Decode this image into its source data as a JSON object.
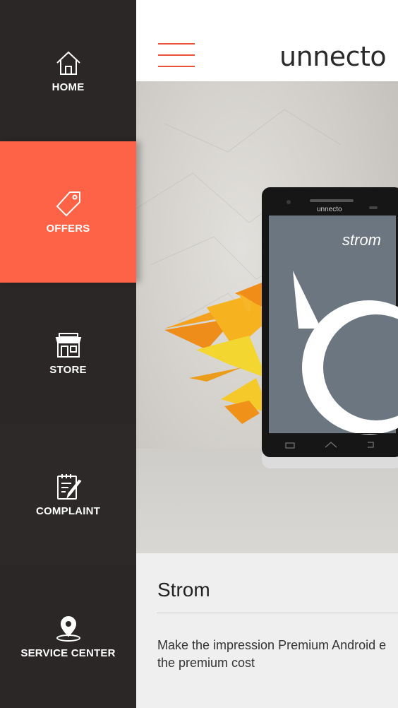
{
  "sidebar": {
    "items": [
      {
        "label": "HOME",
        "icon": "home-icon"
      },
      {
        "label": "OFFERS",
        "icon": "tag-icon"
      },
      {
        "label": "STORE",
        "icon": "store-icon"
      },
      {
        "label": "COMPLAINT",
        "icon": "complaint-icon"
      },
      {
        "label": "SERVICE CENTER",
        "icon": "location-pin-icon"
      }
    ],
    "active_index": 1
  },
  "header": {
    "logo_text": "unnecto"
  },
  "hero": {
    "phone_brand": "unnecto",
    "screen_text": "strom"
  },
  "product": {
    "title": "Strom",
    "description_line1": "Make the impression Premium Android e",
    "description_line2": "the premium cost"
  },
  "colors": {
    "accent": "#ff6347",
    "sidebar_bg": "#2b2727",
    "sidebar_alt_bg": "#292525",
    "menu_icon": "#e8513a"
  }
}
